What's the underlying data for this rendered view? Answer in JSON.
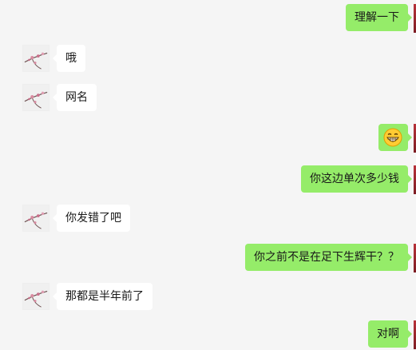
{
  "chat": {
    "messages": [
      {
        "side": "out",
        "text": "理解一下"
      },
      {
        "side": "in",
        "text": "哦"
      },
      {
        "side": "in",
        "text": "网名"
      },
      {
        "side": "out",
        "text": "",
        "icon": "grinning-face-emoji-icon"
      },
      {
        "side": "out",
        "text": "你这边单次多少钱"
      },
      {
        "side": "in",
        "text": "你发错了吧"
      },
      {
        "side": "out",
        "text": "你之前不是在足下生辉干？？"
      },
      {
        "side": "in",
        "text": "那都是半年前了"
      },
      {
        "side": "out",
        "text": "对啊"
      }
    ]
  },
  "colors": {
    "background": "#f5f5f5",
    "incoming_bubble": "#ffffff",
    "outgoing_bubble": "#95ec69",
    "text": "#191919"
  }
}
